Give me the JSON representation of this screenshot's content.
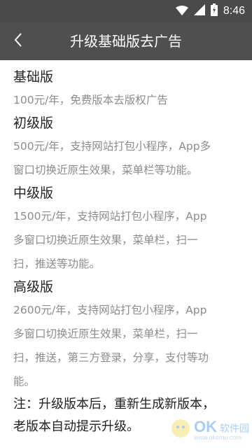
{
  "status_bar": {
    "time": "8:46",
    "icons": [
      "wifi-icon",
      "signal-icon",
      "battery-icon"
    ]
  },
  "app_bar": {
    "back_icon": "chevron-left-icon",
    "title": "升级基础版去广告"
  },
  "tiers": [
    {
      "name": "基础版",
      "desc_lines": [
        "100元/年，免费版本去版权广告"
      ]
    },
    {
      "name": "初级版",
      "desc_lines": [
        "500元/年，支持网站打包小程序，App多",
        "窗口切换近原生效果，菜单栏等功能。"
      ]
    },
    {
      "name": "中级版",
      "desc_lines": [
        "1500元/年，支持网站打包小程序，App",
        "多窗口切换近原生效果，菜单栏，扫一",
        "扫，推送等功能。"
      ]
    },
    {
      "name": "高级版",
      "desc_lines": [
        "2600元/年，支持网站打包小程序，App",
        "多窗口切换近原生效果，菜单栏，扫一",
        "扫，推送，第三方登录，分享，支付等功",
        "能。"
      ]
    }
  ],
  "note_lines": [
    "注：升级版本后，重新生成新版本，",
    "老版本自动提示升级。"
  ],
  "watermark": {
    "main": "OK",
    "sub": "软件园",
    "url": "www.okemu.com"
  },
  "colors": {
    "status_bar": "#4a4a4a",
    "app_bar": "#4f4f4f",
    "heading": "#222222",
    "description": "#8c8c8c"
  }
}
